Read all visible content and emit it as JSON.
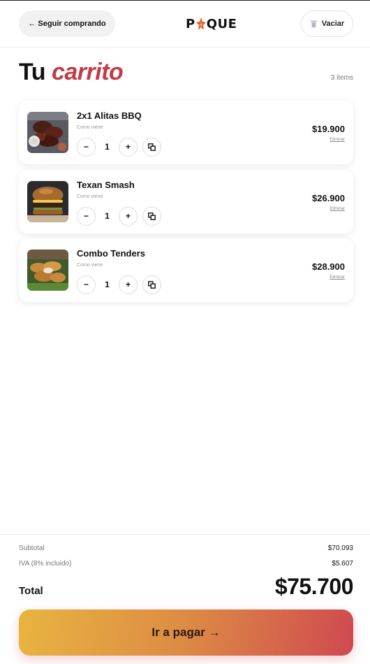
{
  "header": {
    "back_label": "← Seguir comprando",
    "logo_left": "P",
    "logo_right": "QUE",
    "clear_label": "Vaciar"
  },
  "cart": {
    "title_plain": "Tu",
    "title_accent": "carrito",
    "count_label": "3 items",
    "items": [
      {
        "name": "2x1 Alitas BBQ",
        "variant": "Como viene",
        "quantity": "1",
        "price": "$19.900",
        "remove_label": "Eliminar",
        "image": "bbq-wings-photo"
      },
      {
        "name": "Texan Smash",
        "variant": "Como viene",
        "quantity": "1",
        "price": "$26.900",
        "remove_label": "Eliminar",
        "image": "burger-photo"
      },
      {
        "name": "Combo Tenders",
        "variant": "Como viene",
        "quantity": "1",
        "price": "$28.900",
        "remove_label": "Eliminar",
        "image": "tenders-photo"
      }
    ],
    "decrement_symbol": "−",
    "increment_symbol": "+"
  },
  "summary": {
    "subtotal_label": "Subtotal",
    "subtotal_value": "$70.093",
    "tax_label": "IVA (8% incluido)",
    "tax_value": "$5.607",
    "total_label": "Total",
    "total_value": "$75.700",
    "pay_label": "Ir a pagar →"
  },
  "colors": {
    "accent": "#c23b45",
    "pay_gradient_start": "#e8b540",
    "pay_gradient_end": "#cf4950"
  }
}
